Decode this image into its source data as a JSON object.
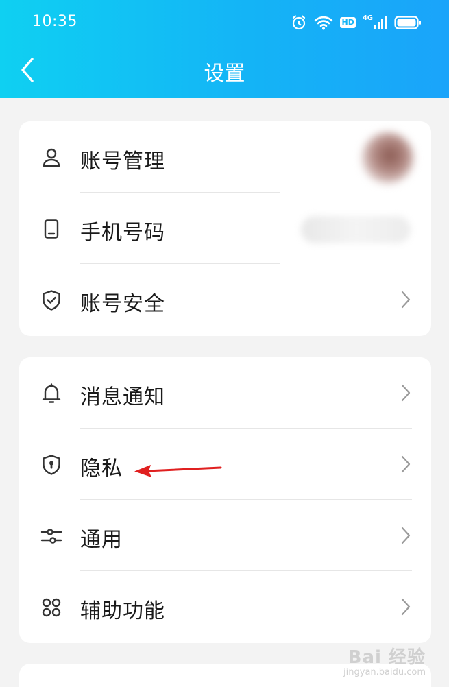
{
  "status_bar": {
    "time": "10:35",
    "network_label": "4G",
    "hd_label": "HD"
  },
  "header": {
    "title": "设置",
    "background_color": "#14b4f6"
  },
  "groups": [
    {
      "items": [
        {
          "label": "账号管理",
          "icon": "user-icon"
        },
        {
          "label": "手机号码",
          "icon": "phone-icon"
        },
        {
          "label": "账号安全",
          "icon": "shield-check-icon"
        }
      ]
    },
    {
      "items": [
        {
          "label": "消息通知",
          "icon": "bell-icon"
        },
        {
          "label": "隐私",
          "icon": "privacy-shield-icon"
        },
        {
          "label": "通用",
          "icon": "sliders-icon"
        },
        {
          "label": "辅助功能",
          "icon": "grid-icon"
        }
      ]
    }
  ],
  "annotation": {
    "color": "#e02020",
    "target": "隐私"
  },
  "watermark": {
    "main": "Bai 经验",
    "sub": "jingyan.baidu.com"
  }
}
